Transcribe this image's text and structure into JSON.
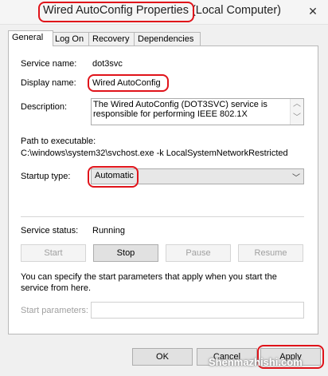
{
  "window": {
    "title": "Wired AutoConfig Properties (Local Computer)",
    "close_symbol": "✕"
  },
  "tabs": [
    {
      "label": "General",
      "active": true
    },
    {
      "label": "Log On",
      "active": false
    },
    {
      "label": "Recovery",
      "active": false
    },
    {
      "label": "Dependencies",
      "active": false
    }
  ],
  "general": {
    "service_name_label": "Service name:",
    "service_name_value": "dot3svc",
    "display_name_label": "Display name:",
    "display_name_value": "Wired AutoConfig",
    "description_label": "Description:",
    "description_value": "The Wired AutoConfig (DOT3SVC) service is responsible for performing IEEE 802.1X",
    "path_label": "Path to executable:",
    "path_value": "C:\\windows\\system32\\svchost.exe -k LocalSystemNetworkRestricted",
    "startup_type_label": "Startup type:",
    "startup_type_value": "Automatic",
    "service_status_label": "Service status:",
    "service_status_value": "Running",
    "buttons": {
      "start": "Start",
      "stop": "Stop",
      "pause": "Pause",
      "resume": "Resume"
    },
    "start_params_info": "You can specify the start parameters that apply when you start the service from here.",
    "start_params_label": "Start parameters:",
    "start_params_value": ""
  },
  "footer": {
    "ok": "OK",
    "cancel": "Cancel",
    "apply": "Apply"
  },
  "watermark": "Shenmazhishi.com",
  "colors": {
    "highlight": "#e0131a",
    "panel_bg": "#ffffff",
    "dialog_bg": "#f0f0f0"
  }
}
